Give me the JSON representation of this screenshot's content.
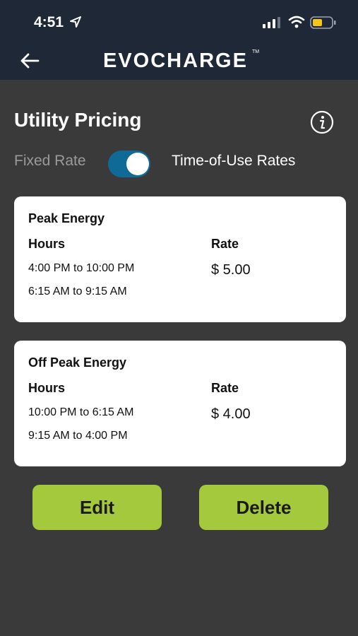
{
  "status_bar": {
    "time": "4:51"
  },
  "header": {
    "brand": "EVOCHARGE",
    "trademark": "TM"
  },
  "page": {
    "title": "Utility Pricing"
  },
  "rate_toggle": {
    "left_label": "Fixed Rate",
    "right_label": "Time-of-Use Rates",
    "on": true,
    "accent": "#0f6a98"
  },
  "cards": [
    {
      "title": "Peak Energy",
      "hours_label": "Hours",
      "rate_label": "Rate",
      "hours": [
        "4:00 PM to 10:00 PM",
        "6:15 AM to 9:15 AM"
      ],
      "rate": "$ 5.00"
    },
    {
      "title": "Off Peak Energy",
      "hours_label": "Hours",
      "rate_label": "Rate",
      "hours": [
        "10:00 PM to 6:15 AM",
        "9:15 AM to 4:00 PM"
      ],
      "rate": "$ 4.00"
    }
  ],
  "actions": {
    "edit_label": "Edit",
    "delete_label": "Delete",
    "button_color": "#a5c93c"
  },
  "icons": [
    "location-arrow-icon",
    "signal-icon",
    "wifi-icon",
    "battery-icon",
    "back-arrow-icon",
    "info-icon"
  ]
}
